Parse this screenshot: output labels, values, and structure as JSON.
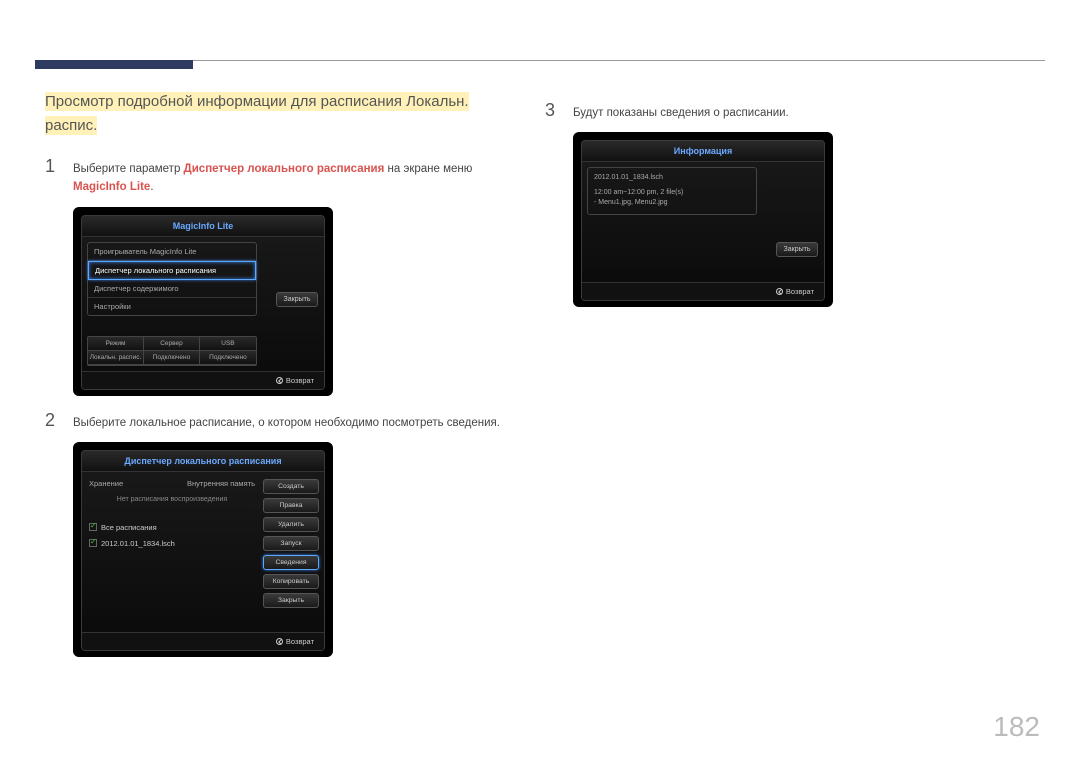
{
  "section_title_line1": "Просмотр подробной информации для расписания Локальн.",
  "section_title_line2": "распис.",
  "page_number": "182",
  "return_label": "Возврат",
  "step1": {
    "num": "1",
    "text_a": "Выберите параметр ",
    "highlight1": "Диспетчер локального расписания",
    "text_b": " на экране меню ",
    "highlight2": "MagicInfo Lite",
    "text_c": "."
  },
  "step2": {
    "num": "2",
    "text": "Выберите локальное расписание, о котором необходимо посмотреть сведения."
  },
  "step3": {
    "num": "3",
    "text": "Будут показаны сведения о расписании."
  },
  "device1": {
    "title": "MagicInfo Lite",
    "items": [
      "Проигрыватель MagicInfo Lite",
      "Диспетчер локального расписания",
      "Диспетчер содержимого",
      "Настройки"
    ],
    "close": "Закрыть",
    "status_headers": [
      "Режим",
      "Сервер",
      "USB"
    ],
    "status_values": [
      "Локальн. распис.",
      "Подключено",
      "Подключено"
    ]
  },
  "device2": {
    "title": "Диспетчер локального расписания",
    "storage_label": "Хранение",
    "storage_value": "Внутренняя память",
    "no_schedule": "Нет расписания воспроизведения",
    "all": "Все расписания",
    "item": "2012.01.01_1834.lsch",
    "buttons": [
      "Создать",
      "Правка",
      "Удалить",
      "Запуск",
      "Сведения",
      "Копировать",
      "Закрыть"
    ],
    "active_btn": "Сведения"
  },
  "device3": {
    "title": "Информация",
    "line1": "2012.01.01_1834.lsch",
    "line2": "12:00 am~12:00 pm, 2 file(s)",
    "line3": "- Menu1.jpg, Menu2.jpg",
    "close": "Закрыть"
  }
}
